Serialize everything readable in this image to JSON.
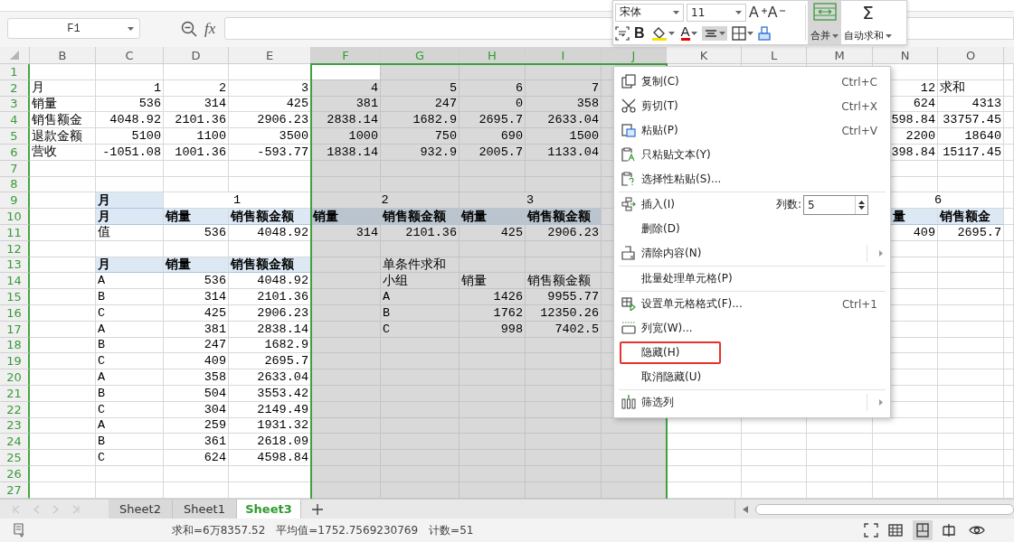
{
  "mini_toolbar": {
    "font": "宋体",
    "size": "11",
    "grow_glyph": "A",
    "shrink_glyph": "A",
    "bold_glyph": "B",
    "color_glyph": "A",
    "align_on": true,
    "merge_on": true,
    "merge_label": "合并",
    "autosum_glyph": "Σ",
    "autosum_label": "自动求和"
  },
  "formula_bar": {
    "name_box": "F1",
    "fx": "fx"
  },
  "columns": [
    {
      "label": "B",
      "selected": false
    },
    {
      "label": "C",
      "selected": false
    },
    {
      "label": "D",
      "selected": false
    },
    {
      "label": "E",
      "selected": false
    },
    {
      "label": "F",
      "selected": true
    },
    {
      "label": "G",
      "selected": true
    },
    {
      "label": "H",
      "selected": true
    },
    {
      "label": "I",
      "selected": true
    },
    {
      "label": "J",
      "selected": true
    },
    {
      "label": "K",
      "selected": false
    },
    {
      "label": "L",
      "selected": false
    },
    {
      "label": "M",
      "selected": false
    },
    {
      "label": "N",
      "selected": false
    },
    {
      "label": "O",
      "selected": false
    }
  ],
  "rows": [
    {
      "number": "1",
      "selected": true,
      "cells": [
        {
          "kind": "blank"
        },
        {
          "kind": "blank"
        },
        {
          "kind": "blank"
        },
        {
          "kind": "blank"
        },
        {
          "kind": "active"
        }
      ]
    },
    {
      "number": "2",
      "selected": true,
      "cells": [
        {
          "kind": "text",
          "text": "月"
        },
        {
          "kind": "number",
          "text": "1"
        },
        {
          "kind": "number",
          "text": "2"
        },
        {
          "kind": "number",
          "text": "3"
        },
        {
          "kind": "number",
          "text": "4"
        },
        {
          "kind": "number",
          "text": "5"
        },
        {
          "kind": "number",
          "text": "6"
        },
        {
          "kind": "number",
          "text": "7"
        },
        {
          "kind": "blank"
        },
        {
          "kind": "blank"
        },
        {
          "kind": "blank"
        },
        {
          "kind": "blank"
        },
        {
          "kind": "number",
          "text": "12"
        },
        {
          "kind": "text",
          "text": "求和"
        }
      ]
    },
    {
      "number": "3",
      "selected": true,
      "cells": [
        {
          "kind": "text",
          "text": "销量"
        },
        {
          "kind": "number",
          "text": "536"
        },
        {
          "kind": "number",
          "text": "314"
        },
        {
          "kind": "number",
          "text": "425"
        },
        {
          "kind": "number",
          "text": "381"
        },
        {
          "kind": "number",
          "text": "247"
        },
        {
          "kind": "number",
          "text": "0"
        },
        {
          "kind": "number",
          "text": "358"
        },
        {
          "kind": "blank"
        },
        {
          "kind": "blank"
        },
        {
          "kind": "blank"
        },
        {
          "kind": "blank"
        },
        {
          "kind": "number",
          "text": "624"
        },
        {
          "kind": "number",
          "text": "4313"
        }
      ]
    },
    {
      "number": "4",
      "selected": true,
      "cells": [
        {
          "kind": "text",
          "text": "销售额金"
        },
        {
          "kind": "number",
          "text": "4048.92"
        },
        {
          "kind": "number",
          "text": "2101.36"
        },
        {
          "kind": "number",
          "text": "2906.23"
        },
        {
          "kind": "number",
          "text": "2838.14"
        },
        {
          "kind": "number",
          "text": "1682.9"
        },
        {
          "kind": "number",
          "text": "2695.7"
        },
        {
          "kind": "number",
          "text": "2633.04"
        },
        {
          "kind": "blank"
        },
        {
          "kind": "blank"
        },
        {
          "kind": "blank"
        },
        {
          "kind": "blank"
        },
        {
          "kind": "number",
          "text": "598.84"
        },
        {
          "kind": "number",
          "text": "33757.45"
        }
      ]
    },
    {
      "number": "5",
      "selected": true,
      "cells": [
        {
          "kind": "text",
          "text": "退款金额"
        },
        {
          "kind": "number",
          "text": "5100"
        },
        {
          "kind": "number",
          "text": "1100"
        },
        {
          "kind": "number",
          "text": "3500"
        },
        {
          "kind": "number",
          "text": "1000"
        },
        {
          "kind": "number",
          "text": "750"
        },
        {
          "kind": "number",
          "text": "690"
        },
        {
          "kind": "number",
          "text": "1500"
        },
        {
          "kind": "blank"
        },
        {
          "kind": "blank"
        },
        {
          "kind": "blank"
        },
        {
          "kind": "blank"
        },
        {
          "kind": "number",
          "text": "2200"
        },
        {
          "kind": "number",
          "text": "18640"
        }
      ]
    },
    {
      "number": "6",
      "selected": true,
      "cells": [
        {
          "kind": "text",
          "text": "营收"
        },
        {
          "kind": "number",
          "text": "-1051.08"
        },
        {
          "kind": "number",
          "text": "1001.36"
        },
        {
          "kind": "number",
          "text": "-593.77"
        },
        {
          "kind": "number",
          "text": "1838.14"
        },
        {
          "kind": "number",
          "text": "932.9"
        },
        {
          "kind": "number",
          "text": "2005.7"
        },
        {
          "kind": "number",
          "text": "1133.04"
        },
        {
          "kind": "blank"
        },
        {
          "kind": "blank"
        },
        {
          "kind": "blank"
        },
        {
          "kind": "blank"
        },
        {
          "kind": "number",
          "text": "398.84"
        },
        {
          "kind": "number",
          "text": "15117.45"
        }
      ]
    },
    {
      "number": "7",
      "selected": true
    },
    {
      "number": "8",
      "selected": true
    },
    {
      "number": "9",
      "selected": true,
      "cells": [
        {
          "kind": "blank"
        },
        {
          "kind": "header",
          "text": "月"
        },
        {
          "kind": "title",
          "text": "1"
        },
        {
          "kind": "title",
          "text": "2"
        },
        {
          "kind": "title",
          "text": "3"
        },
        {
          "kind": "blank"
        },
        {
          "kind": "blank"
        },
        {
          "kind": "blank"
        },
        {
          "kind": "blank"
        },
        {
          "kind": "title",
          "text": "6"
        }
      ]
    },
    {
      "number": "10",
      "selected": true,
      "cells": [
        {
          "kind": "blank"
        },
        {
          "kind": "header",
          "text": "月"
        },
        {
          "kind": "header",
          "text": "销量"
        },
        {
          "kind": "header",
          "text": "销售额金额"
        },
        {
          "kind": "header",
          "text": "销量"
        },
        {
          "kind": "header",
          "text": "销售额金额"
        },
        {
          "kind": "header",
          "text": "销量"
        },
        {
          "kind": "header",
          "text": "销售额金额"
        },
        {
          "kind": "blank"
        },
        {
          "kind": "blank"
        },
        {
          "kind": "blank"
        },
        {
          "kind": "blank"
        },
        {
          "kind": "tail",
          "text": "量"
        },
        {
          "kind": "header",
          "text": "销售额金"
        }
      ]
    },
    {
      "number": "11",
      "selected": true,
      "cells": [
        {
          "kind": "blank"
        },
        {
          "kind": "text",
          "text": "值"
        },
        {
          "kind": "number",
          "text": "536"
        },
        {
          "kind": "number",
          "text": "4048.92"
        },
        {
          "kind": "number",
          "text": "314"
        },
        {
          "kind": "number",
          "text": "2101.36"
        },
        {
          "kind": "number",
          "text": "425"
        },
        {
          "kind": "number",
          "text": "2906.23"
        },
        {
          "kind": "blank"
        },
        {
          "kind": "blank"
        },
        {
          "kind": "blank"
        },
        {
          "kind": "blank"
        },
        {
          "kind": "number",
          "text": "409"
        },
        {
          "kind": "number",
          "text": "2695.7"
        }
      ]
    },
    {
      "number": "12",
      "selected": true
    },
    {
      "number": "13",
      "selected": true,
      "cells": [
        {
          "kind": "blank"
        },
        {
          "kind": "header",
          "text": "月"
        },
        {
          "kind": "header",
          "text": "销量"
        },
        {
          "kind": "header",
          "text": "销售额金额"
        },
        {
          "kind": "blank"
        },
        {
          "kind": "text",
          "text": "单条件求和"
        }
      ]
    },
    {
      "number": "14",
      "selected": true,
      "cells": [
        {
          "kind": "blank"
        },
        {
          "kind": "text",
          "text": "A"
        },
        {
          "kind": "number",
          "text": "536"
        },
        {
          "kind": "number",
          "text": "4048.92"
        },
        {
          "kind": "blank"
        },
        {
          "kind": "text",
          "text": "小组"
        },
        {
          "kind": "text",
          "text": "销量"
        },
        {
          "kind": "text",
          "text": "销售额金额"
        }
      ]
    },
    {
      "number": "15",
      "selected": true,
      "cells": [
        {
          "kind": "blank"
        },
        {
          "kind": "text",
          "text": "B"
        },
        {
          "kind": "number",
          "text": "314"
        },
        {
          "kind": "number",
          "text": "2101.36"
        },
        {
          "kind": "blank"
        },
        {
          "kind": "text",
          "text": "A"
        },
        {
          "kind": "number",
          "text": "1426"
        },
        {
          "kind": "number",
          "text": "9955.77"
        }
      ]
    },
    {
      "number": "16",
      "selected": true,
      "cells": [
        {
          "kind": "blank"
        },
        {
          "kind": "text",
          "text": "C"
        },
        {
          "kind": "number",
          "text": "425"
        },
        {
          "kind": "number",
          "text": "2906.23"
        },
        {
          "kind": "blank"
        },
        {
          "kind": "text",
          "text": "B"
        },
        {
          "kind": "number",
          "text": "1762"
        },
        {
          "kind": "number",
          "text": "12350.26"
        }
      ]
    },
    {
      "number": "17",
      "selected": true,
      "cells": [
        {
          "kind": "blank"
        },
        {
          "kind": "text",
          "text": "A"
        },
        {
          "kind": "number",
          "text": "381"
        },
        {
          "kind": "number",
          "text": "2838.14"
        },
        {
          "kind": "blank"
        },
        {
          "kind": "text",
          "text": "C"
        },
        {
          "kind": "number",
          "text": "998"
        },
        {
          "kind": "number",
          "text": "7402.5"
        }
      ]
    },
    {
      "number": "18",
      "selected": true,
      "cells": [
        {
          "kind": "blank"
        },
        {
          "kind": "text",
          "text": "B"
        },
        {
          "kind": "number",
          "text": "247"
        },
        {
          "kind": "number",
          "text": "1682.9"
        }
      ]
    },
    {
      "number": "19",
      "selected": true,
      "cells": [
        {
          "kind": "blank"
        },
        {
          "kind": "text",
          "text": "C"
        },
        {
          "kind": "number",
          "text": "409"
        },
        {
          "kind": "number",
          "text": "2695.7"
        }
      ]
    },
    {
      "number": "20",
      "selected": true,
      "cells": [
        {
          "kind": "blank"
        },
        {
          "kind": "text",
          "text": "A"
        },
        {
          "kind": "number",
          "text": "358"
        },
        {
          "kind": "number",
          "text": "2633.04"
        }
      ]
    },
    {
      "number": "21",
      "selected": true,
      "cells": [
        {
          "kind": "blank"
        },
        {
          "kind": "text",
          "text": "B"
        },
        {
          "kind": "number",
          "text": "504"
        },
        {
          "kind": "number",
          "text": "3553.42"
        }
      ]
    },
    {
      "number": "22",
      "selected": true,
      "cells": [
        {
          "kind": "blank"
        },
        {
          "kind": "text",
          "text": "C"
        },
        {
          "kind": "number",
          "text": "304"
        },
        {
          "kind": "number",
          "text": "2149.49"
        }
      ]
    },
    {
      "number": "23",
      "selected": true,
      "cells": [
        {
          "kind": "blank"
        },
        {
          "kind": "text",
          "text": "A"
        },
        {
          "kind": "number",
          "text": "259"
        },
        {
          "kind": "number",
          "text": "1931.32"
        }
      ]
    },
    {
      "number": "24",
      "selected": true,
      "cells": [
        {
          "kind": "blank"
        },
        {
          "kind": "text",
          "text": "B"
        },
        {
          "kind": "number",
          "text": "361"
        },
        {
          "kind": "number",
          "text": "2618.09"
        }
      ]
    },
    {
      "number": "25",
      "selected": true,
      "cells": [
        {
          "kind": "blank"
        },
        {
          "kind": "text",
          "text": "C"
        },
        {
          "kind": "number",
          "text": "624"
        },
        {
          "kind": "number",
          "text": "4598.84"
        }
      ]
    },
    {
      "number": "26",
      "selected": true
    },
    {
      "number": "27",
      "selected": true
    }
  ],
  "context_menu": {
    "groups": [
      [
        {
          "kind": "command",
          "label": "复制(C)",
          "shortcut": "Ctrl+C",
          "has_submenu": false,
          "highlighted": false
        },
        {
          "kind": "command",
          "label": "剪切(T)",
          "shortcut": "Ctrl+X",
          "has_submenu": false,
          "highlighted": false
        },
        {
          "kind": "command",
          "label": "粘贴(P)",
          "shortcut": "Ctrl+V",
          "has_submenu": false,
          "highlighted": false
        },
        {
          "kind": "command",
          "label": "只粘贴文本(Y)",
          "has_submenu": false,
          "highlighted": false
        },
        {
          "kind": "command",
          "label": "选择性粘贴(S)...",
          "has_submenu": false,
          "highlighted": false
        }
      ],
      [
        {
          "kind": "spin",
          "label": "插入(I)",
          "spin_label": "列数:",
          "spin_value": "5",
          "has_submenu": false,
          "highlighted": false
        },
        {
          "kind": "command",
          "label": "删除(D)",
          "has_submenu": false,
          "highlighted": false
        },
        {
          "kind": "command",
          "label": "清除内容(N)",
          "has_submenu": true,
          "highlighted": false
        }
      ],
      [
        {
          "kind": "command",
          "label": "批量处理单元格(P)",
          "has_submenu": false,
          "highlighted": false
        }
      ],
      [
        {
          "kind": "command",
          "label": "设置单元格格式(F)...",
          "shortcut": "Ctrl+1",
          "has_submenu": false,
          "highlighted": false
        },
        {
          "kind": "command",
          "label": "列宽(W)...",
          "has_submenu": false,
          "highlighted": false
        },
        {
          "kind": "command",
          "label": "隐藏(H)",
          "has_submenu": false,
          "highlighted": true
        },
        {
          "kind": "command",
          "label": "取消隐藏(U)",
          "has_submenu": false,
          "highlighted": false
        }
      ],
      [
        {
          "kind": "command",
          "label": "筛选列",
          "has_submenu": true,
          "highlighted": false
        }
      ]
    ]
  },
  "sheet_tabs": [
    {
      "label": "Sheet2",
      "selected": false
    },
    {
      "label": "Sheet1",
      "selected": false
    },
    {
      "label": "Sheet3",
      "selected": true
    }
  ],
  "status_bar": {
    "sum": "求和=6万8357.52",
    "average": "平均值=1752.7569230769",
    "count": "计数=51",
    "views": [
      {
        "selected": false
      },
      {
        "selected": true
      },
      {
        "selected": false
      },
      {
        "selected": false
      }
    ]
  }
}
